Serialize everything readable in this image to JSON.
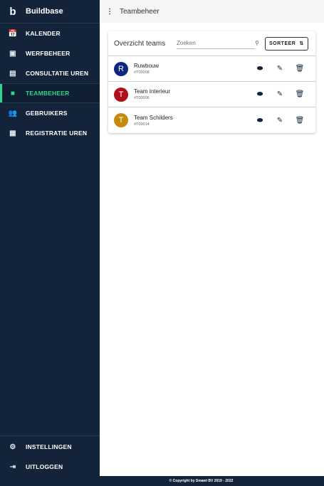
{
  "brand": {
    "logo": "b",
    "name": "Buildbase"
  },
  "nav": [
    {
      "label": "KALENDER",
      "icon": "calendar-clock-icon",
      "glyph": "📅"
    },
    {
      "label": "WERFBEHEER",
      "icon": "id-card-icon",
      "glyph": "▣"
    },
    {
      "label": "CONSULTATIE UREN",
      "icon": "document-icon",
      "glyph": "▤"
    },
    {
      "label": "TEAMBEHEER",
      "icon": "team-icon",
      "glyph": "■"
    },
    {
      "label": "GEBRUIKERS",
      "icon": "users-icon",
      "glyph": "👥"
    },
    {
      "label": "REGISTRATIE UREN",
      "icon": "calendar-person-icon",
      "glyph": "▦"
    }
  ],
  "nav_bottom": [
    {
      "label": "INSTELLINGEN",
      "icon": "gear-icon",
      "glyph": "⚙"
    },
    {
      "label": "UITLOGGEN",
      "icon": "logout-icon",
      "glyph": "⇥"
    }
  ],
  "topbar": {
    "menu": "⋮",
    "title": "Teambeheer"
  },
  "card": {
    "title": "Overzicht teams",
    "search_placeholder": "Zoeken",
    "search_glyph": "⚲",
    "sort_label": "SORTEER",
    "sort_glyph": "⇅"
  },
  "teams": [
    {
      "initial": "R",
      "name": "Ruwbouw",
      "code": "#T00008",
      "color": "#0d2680"
    },
    {
      "initial": "T",
      "name": "Team Interieur",
      "code": "#T00006",
      "color": "#b0101c"
    },
    {
      "initial": "T",
      "name": "Team Schilders",
      "code": "#T00014",
      "color": "#c48a0c"
    }
  ],
  "actions": {
    "toggle": "⬬",
    "edit": "✎",
    "delete": "🗑"
  },
  "footer": "© Copyright by Smawt BV 2019 - 2022",
  "colors": {
    "sidebar": "#13243a",
    "accent": "#2fd58a"
  }
}
